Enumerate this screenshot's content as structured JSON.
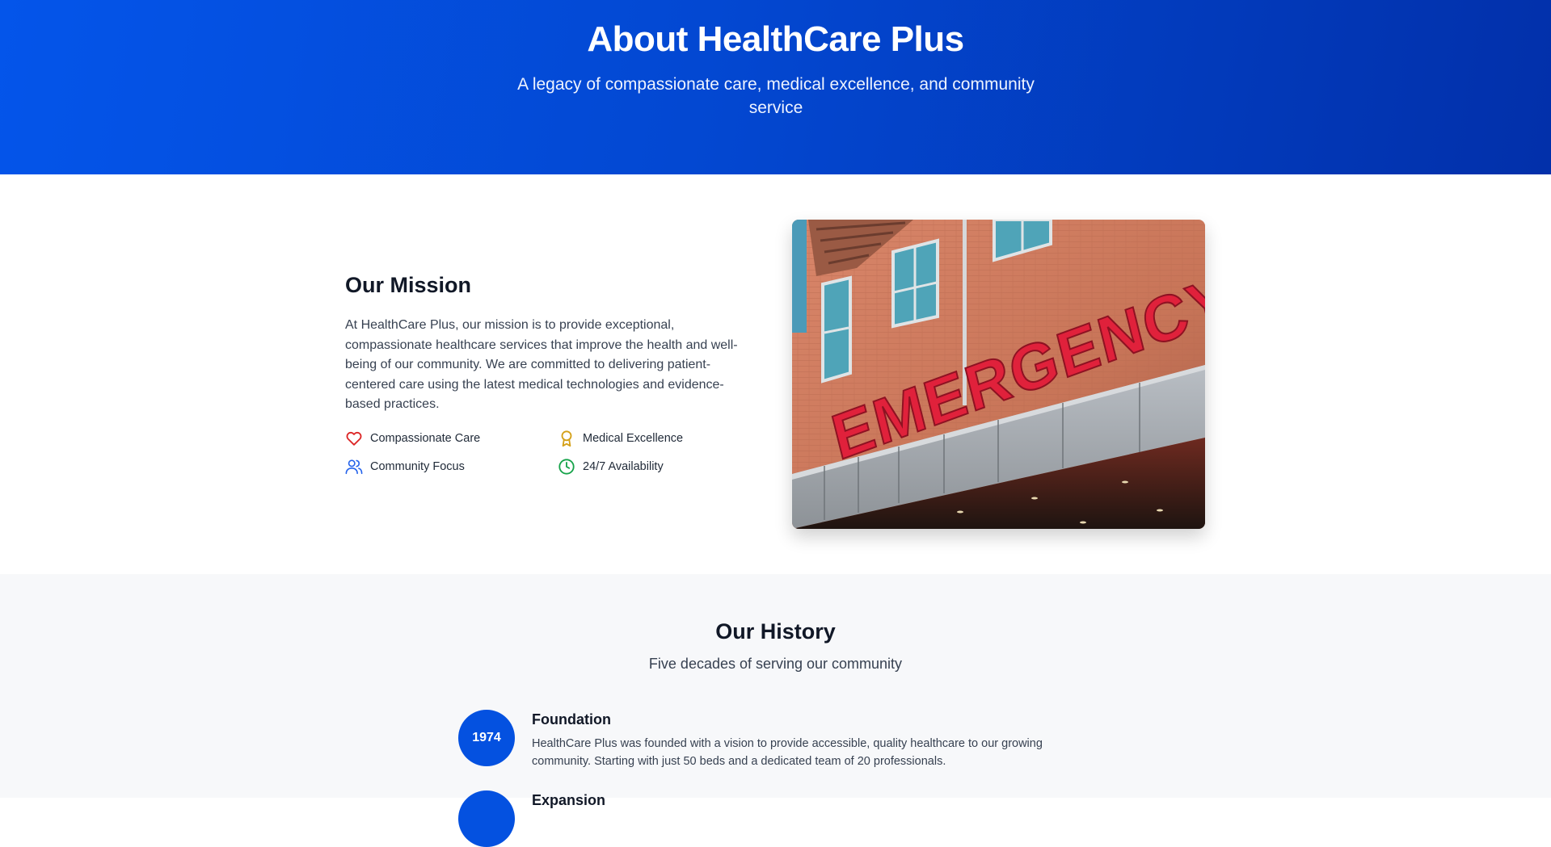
{
  "hero": {
    "title": "About HealthCare Plus",
    "subtitle": "A legacy of compassionate care, medical excellence, and community service"
  },
  "mission": {
    "heading": "Our Mission",
    "paragraph": "At HealthCare Plus, our mission is to provide exceptional, compassionate healthcare services that improve the health and well-being of our community. We are committed to delivering patient-centered care using the latest medical technologies and evidence-based practices.",
    "values": [
      {
        "label": "Compassionate Care",
        "icon": "heart-icon",
        "color": "#dc2626"
      },
      {
        "label": "Medical Excellence",
        "icon": "award-icon",
        "color": "#d4a017"
      },
      {
        "label": "Community Focus",
        "icon": "users-icon",
        "color": "#2563eb"
      },
      {
        "label": "24/7 Availability",
        "icon": "clock-icon",
        "color": "#16a34a"
      }
    ],
    "image": {
      "sign_text": "EMERGENCY"
    }
  },
  "history": {
    "heading": "Our History",
    "subtitle": "Five decades of serving our community",
    "events": [
      {
        "year": "1974",
        "title": "Foundation",
        "description": "HealthCare Plus was founded with a vision to provide accessible, quality healthcare to our growing community. Starting with just 50 beds and a dedicated team of 20 professionals."
      },
      {
        "year": "",
        "title": "Expansion",
        "description": ""
      }
    ]
  },
  "colors": {
    "brand_blue": "#0451e0",
    "hero_start": "#0455ea",
    "hero_end": "#0230aa"
  }
}
